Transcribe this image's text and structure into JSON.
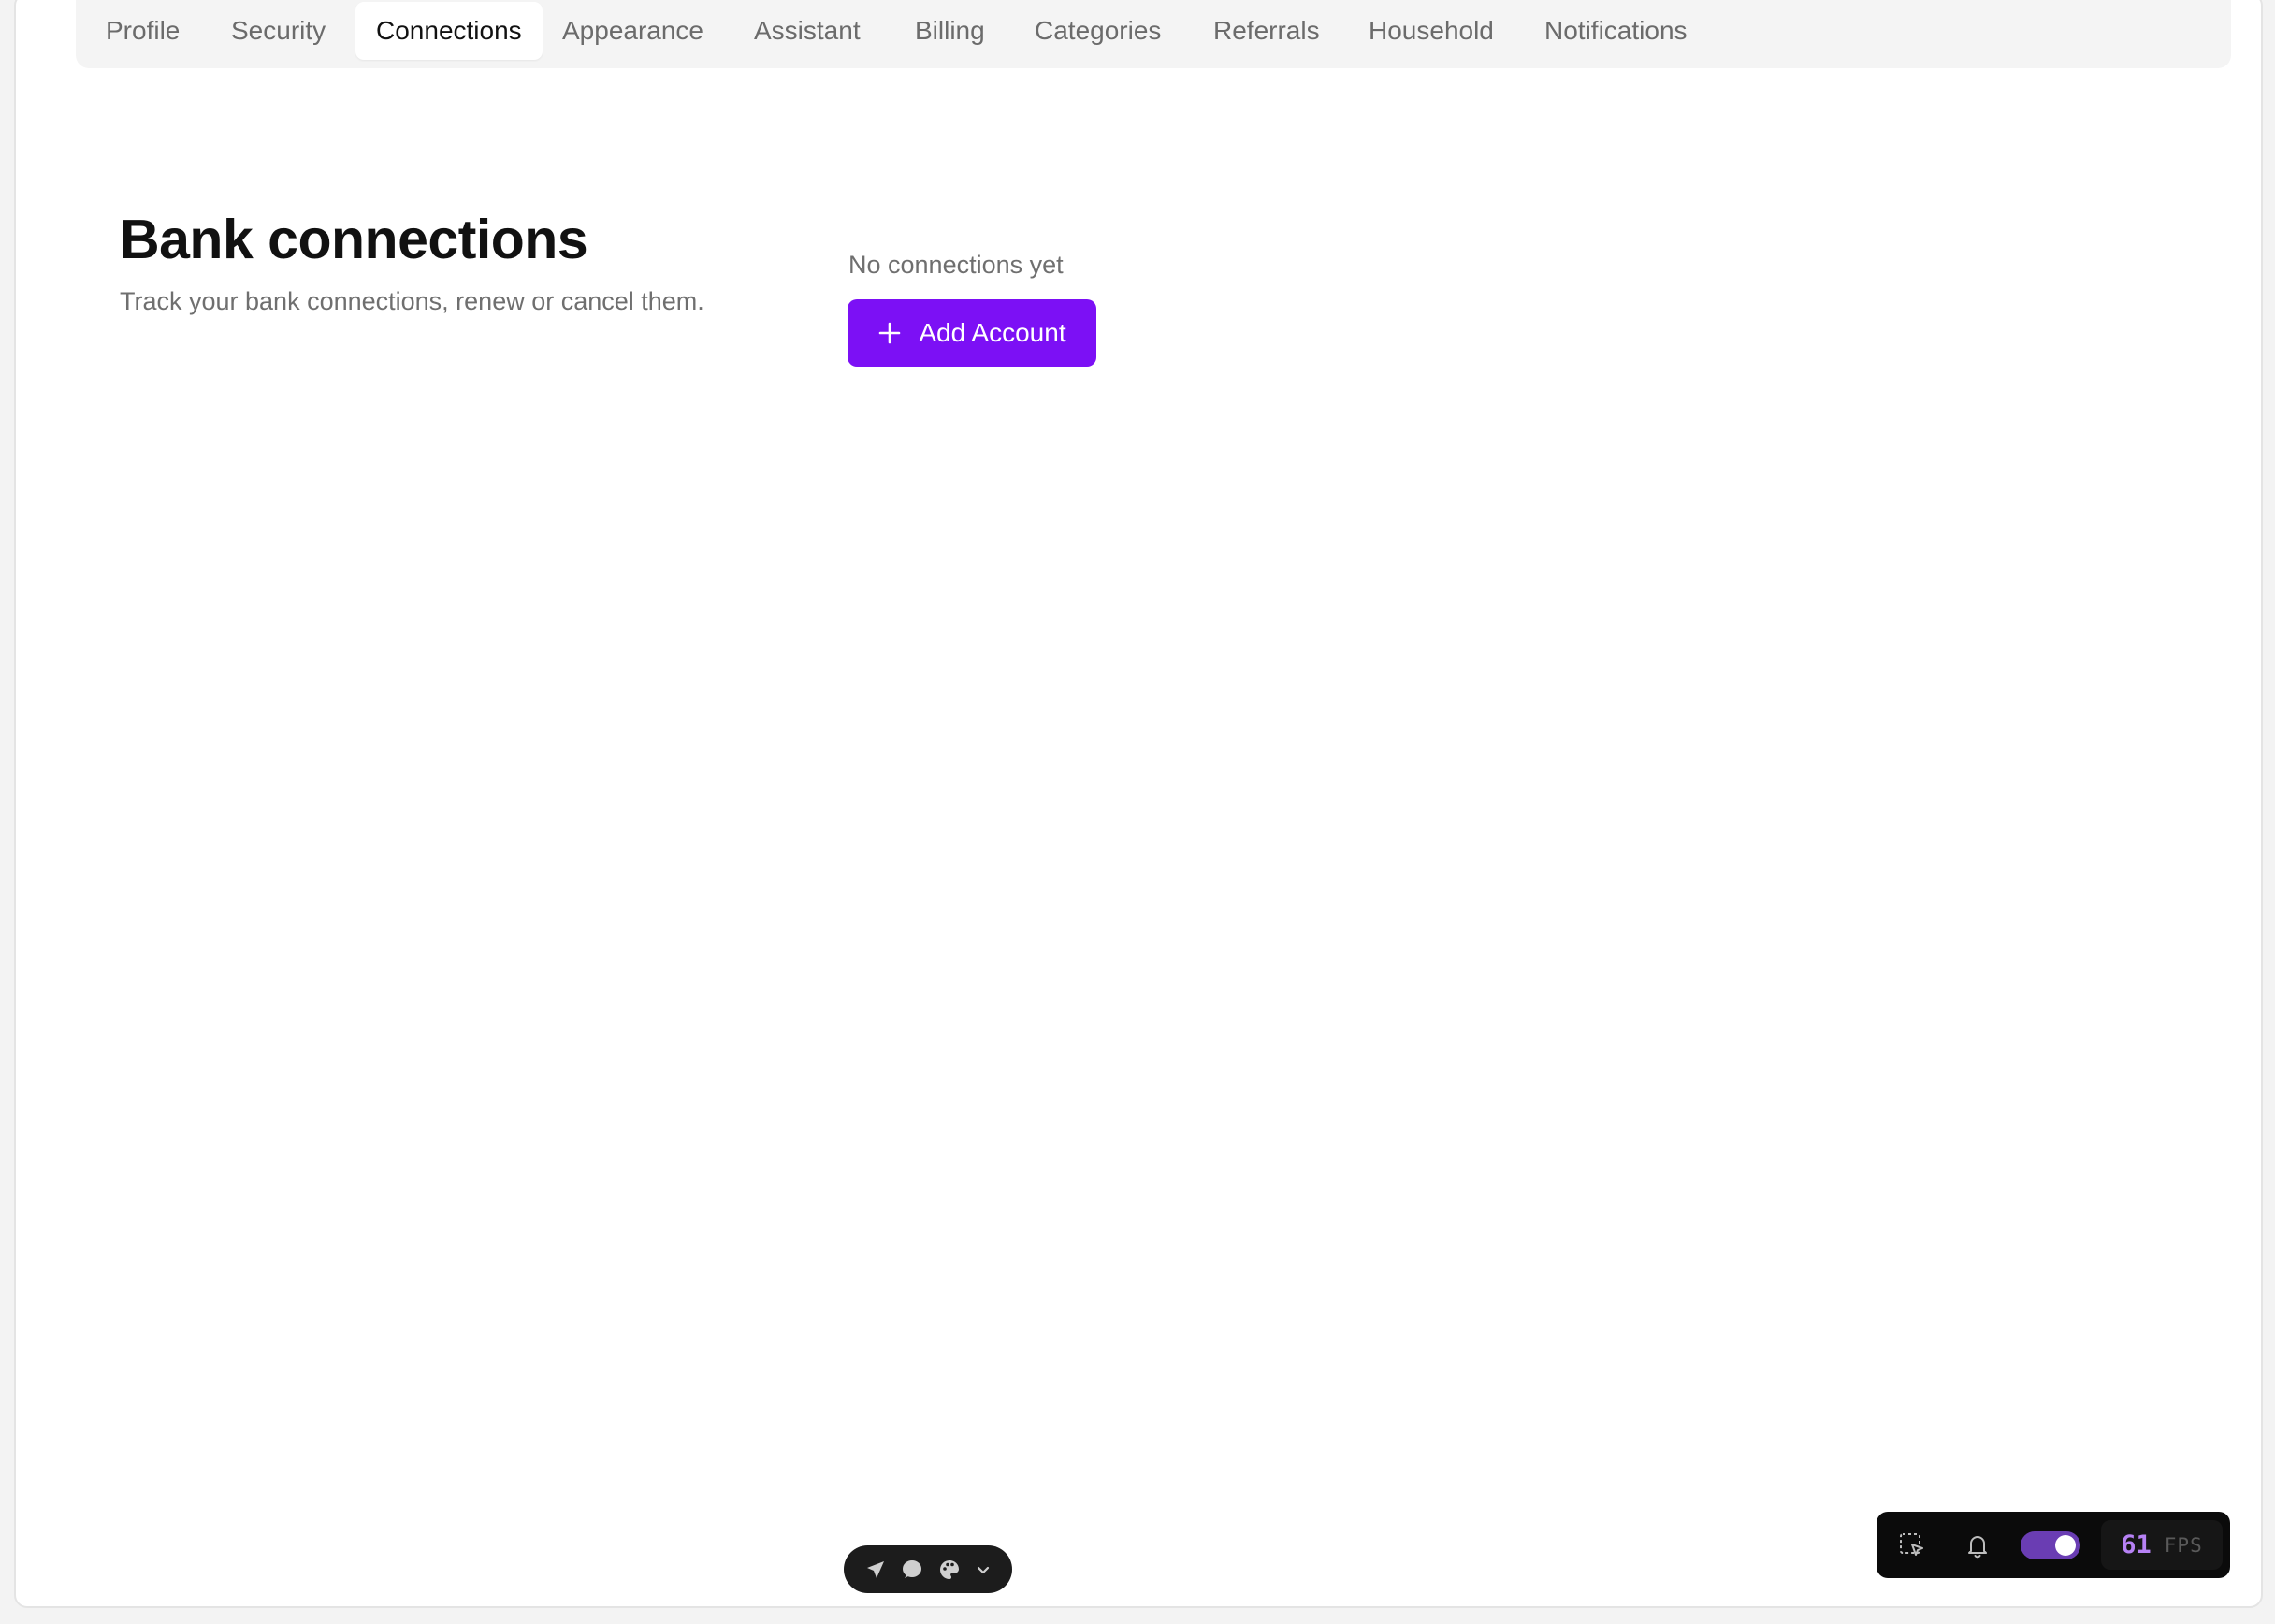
{
  "tabs": [
    {
      "label": "Profile"
    },
    {
      "label": "Security"
    },
    {
      "label": "Connections",
      "active": true
    },
    {
      "label": "Appearance"
    },
    {
      "label": "Assistant"
    },
    {
      "label": "Billing"
    },
    {
      "label": "Categories"
    },
    {
      "label": "Referrals"
    },
    {
      "label": "Household"
    },
    {
      "label": "Notifications"
    }
  ],
  "page": {
    "title": "Bank connections",
    "subtitle": "Track your bank connections, renew or cancel them.",
    "empty_state": "No connections yet",
    "add_button_label": "Add Account"
  },
  "floating_toolbar": {
    "icons": [
      "send-icon",
      "comment-icon",
      "palette-icon",
      "chevron-down-icon"
    ]
  },
  "dev_toolbar": {
    "icons": [
      "select-element-icon",
      "bell-icon"
    ],
    "toggle_on": true,
    "fps_value": "61",
    "fps_label": "FPS"
  },
  "colors": {
    "accent": "#7c10f5",
    "toggle": "#6a3db3",
    "fps_value": "#b782f5"
  }
}
